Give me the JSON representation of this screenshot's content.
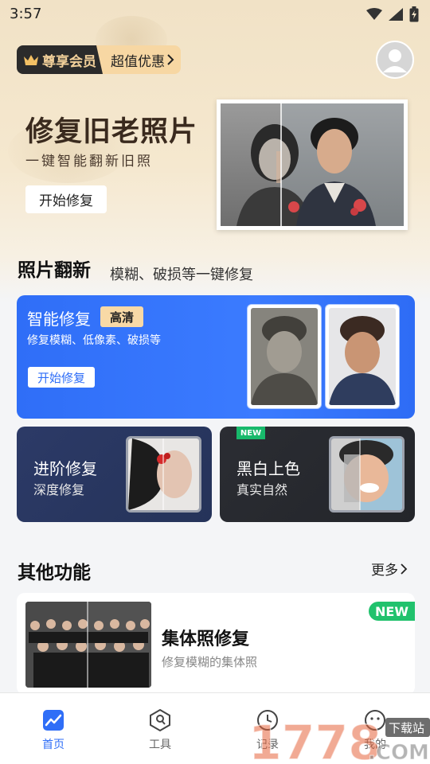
{
  "status_bar": {
    "time": "3:57"
  },
  "membership": {
    "vip_label": "尊享会员",
    "offer_label": "超值优惠"
  },
  "hero": {
    "title": "修复旧老照片",
    "subtitle": "一键智能翻新旧照",
    "button_label": "开始修复"
  },
  "photo_renovation": {
    "title": "照片翻新",
    "subtitle": "模糊、破损等一键修复",
    "smart_repair": {
      "title": "智能修复",
      "badge": "高清",
      "description": "修复模糊、低像素、破损等",
      "button_label": "开始修复"
    },
    "advanced_repair": {
      "title": "进阶修复",
      "subtitle": "深度修复"
    },
    "colorize": {
      "tag": "NEW",
      "title": "黑白上色",
      "subtitle": "真实自然"
    }
  },
  "other_features": {
    "title": "其他功能",
    "more_label": "更多",
    "items": [
      {
        "title": "集体照修复",
        "subtitle": "修复模糊的集体照",
        "tag": "NEW"
      }
    ]
  },
  "bottom_nav": {
    "items": [
      {
        "label": "首页",
        "icon": "home-chart-icon",
        "active": true
      },
      {
        "label": "工具",
        "icon": "tools-icon",
        "active": false
      },
      {
        "label": "记录",
        "icon": "clock-icon",
        "active": false
      },
      {
        "label": "我的",
        "icon": "smiley-icon",
        "active": false
      }
    ]
  },
  "watermark": {
    "text": "1778",
    "sub": "下载站",
    "suffix": ".COM"
  },
  "colors": {
    "accent_blue": "#2f6ef7",
    "gold": "#f7d7a3",
    "new_green": "#21c26d",
    "advanced_card": "#2c3a67",
    "colorize_card": "#2b2d33"
  }
}
